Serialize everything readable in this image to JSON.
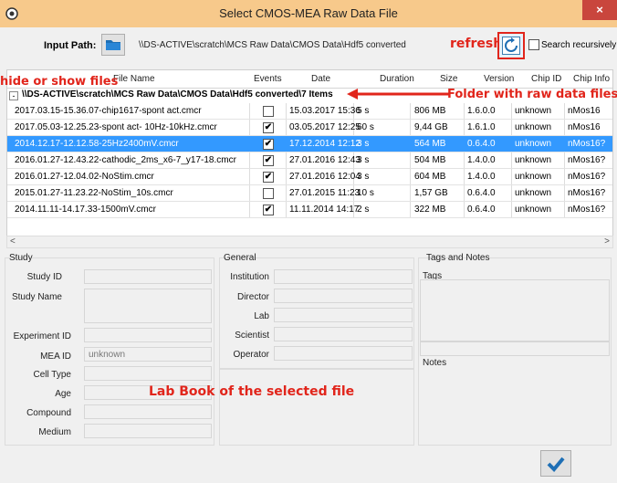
{
  "window": {
    "title": "Select CMOS-MEA Raw Data File",
    "close_label": "×"
  },
  "toolbar": {
    "input_path_label": "Input Path:",
    "input_path_value": "\\\\DS-ACTIVE\\scratch\\MCS Raw Data\\CMOS Data\\Hdf5 converted",
    "search_recursively_label": "Search recursively",
    "search_recursively_checked": false
  },
  "annotations": {
    "refresh": "refresh",
    "hide_show": "hide or show files",
    "folder": "Folder with raw data files",
    "labbook": "Lab Book of the selected file"
  },
  "table": {
    "columns": [
      "File Name",
      "Events",
      "Date",
      "Duration",
      "Size",
      "Version",
      "Chip ID",
      "Chip Info"
    ],
    "group_label": "\\\\DS-ACTIVE\\scratch\\MCS Raw Data\\CMOS Data\\Hdf5 converted\\7 Items",
    "rows": [
      {
        "name": "2017.03.15-15.36.07-chip1617-spont act.cmcr",
        "events": false,
        "date": "15.03.2017 15:36",
        "duration": "5 s",
        "size": "806 MB",
        "version": "1.6.0.0",
        "chip_id": "unknown",
        "chip_info": "nMos16",
        "selected": false
      },
      {
        "name": "2017.05.03-12.25.23-spont act- 10Hz-10kHz.cmcr",
        "events": true,
        "date": "03.05.2017 12:25",
        "duration": "60 s",
        "size": "9,44 GB",
        "version": "1.6.1.0",
        "chip_id": "unknown",
        "chip_info": "nMos16",
        "selected": false
      },
      {
        "name": "2014.12.17-12.12.58-25Hz2400mV.cmcr",
        "events": true,
        "date": "17.12.2014 12:12",
        "duration": "3 s",
        "size": "564 MB",
        "version": "0.6.4.0",
        "chip_id": "unknown",
        "chip_info": "nMos16?",
        "selected": true
      },
      {
        "name": "2016.01.27-12.43.22-cathodic_2ms_x6-7_y17-18.cmcr",
        "events": true,
        "date": "27.01.2016 12:43",
        "duration": "3 s",
        "size": "504 MB",
        "version": "1.4.0.0",
        "chip_id": "unknown",
        "chip_info": "nMos16?",
        "selected": false
      },
      {
        "name": "2016.01.27-12.04.02-NoStim.cmcr",
        "events": true,
        "date": "27.01.2016 12:04",
        "duration": "3 s",
        "size": "604 MB",
        "version": "1.4.0.0",
        "chip_id": "unknown",
        "chip_info": "nMos16?",
        "selected": false
      },
      {
        "name": "2015.01.27-11.23.22-NoStim_10s.cmcr",
        "events": false,
        "date": "27.01.2015 11:23",
        "duration": "10 s",
        "size": "1,57 GB",
        "version": "0.6.4.0",
        "chip_id": "unknown",
        "chip_info": "nMos16?",
        "selected": false
      },
      {
        "name": "2014.11.11-14.17.33-1500mV.cmcr",
        "events": true,
        "date": "11.11.2014 14:17",
        "duration": "2 s",
        "size": "322 MB",
        "version": "0.6.4.0",
        "chip_id": "unknown",
        "chip_info": "nMos16?",
        "selected": false
      }
    ]
  },
  "study": {
    "title": "Study",
    "study_id_label": "Study ID",
    "study_id": "",
    "study_name_label": "Study Name",
    "study_name": "",
    "experiment_id_label": "Experiment ID",
    "experiment_id": "",
    "mea_id_label": "MEA ID",
    "mea_id": "unknown",
    "cell_type_label": "Cell Type",
    "cell_type": "",
    "age_label": "Age",
    "age": "",
    "compound_label": "Compound",
    "compound": "",
    "medium_label": "Medium",
    "medium": ""
  },
  "general": {
    "title": "General",
    "institution_label": "Institution",
    "institution": "",
    "director_label": "Director",
    "director": "",
    "lab_label": "Lab",
    "lab": "",
    "scientist_label": "Scientist",
    "scientist": "",
    "operator_label": "Operator",
    "operator": ""
  },
  "tags_notes": {
    "title": "Tags and Notes",
    "tags_label": "Tags",
    "notes_label": "Notes"
  },
  "colors": {
    "annotation": "#e1251b",
    "selection": "#3399ff",
    "titlebar": "#f7c98b",
    "close": "#c9463d"
  }
}
